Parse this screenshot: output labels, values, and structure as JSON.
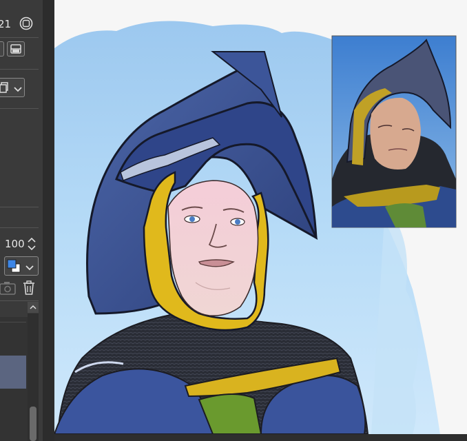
{
  "panel": {
    "top_readout": "21",
    "opacity_value": "100"
  },
  "colors": {
    "panel_bg": "#3a3a3a",
    "selected_layer": "#5b6580",
    "main_color": "#3d86e6",
    "sub_color": "#ffffff"
  },
  "icons": [
    "settings-circle-icon",
    "layer-panel-icon",
    "copy-icon",
    "chevron-down-icon",
    "spinner-icon",
    "color-swatch-icon",
    "camera-icon",
    "trash-icon",
    "scroll-up-icon"
  ]
}
